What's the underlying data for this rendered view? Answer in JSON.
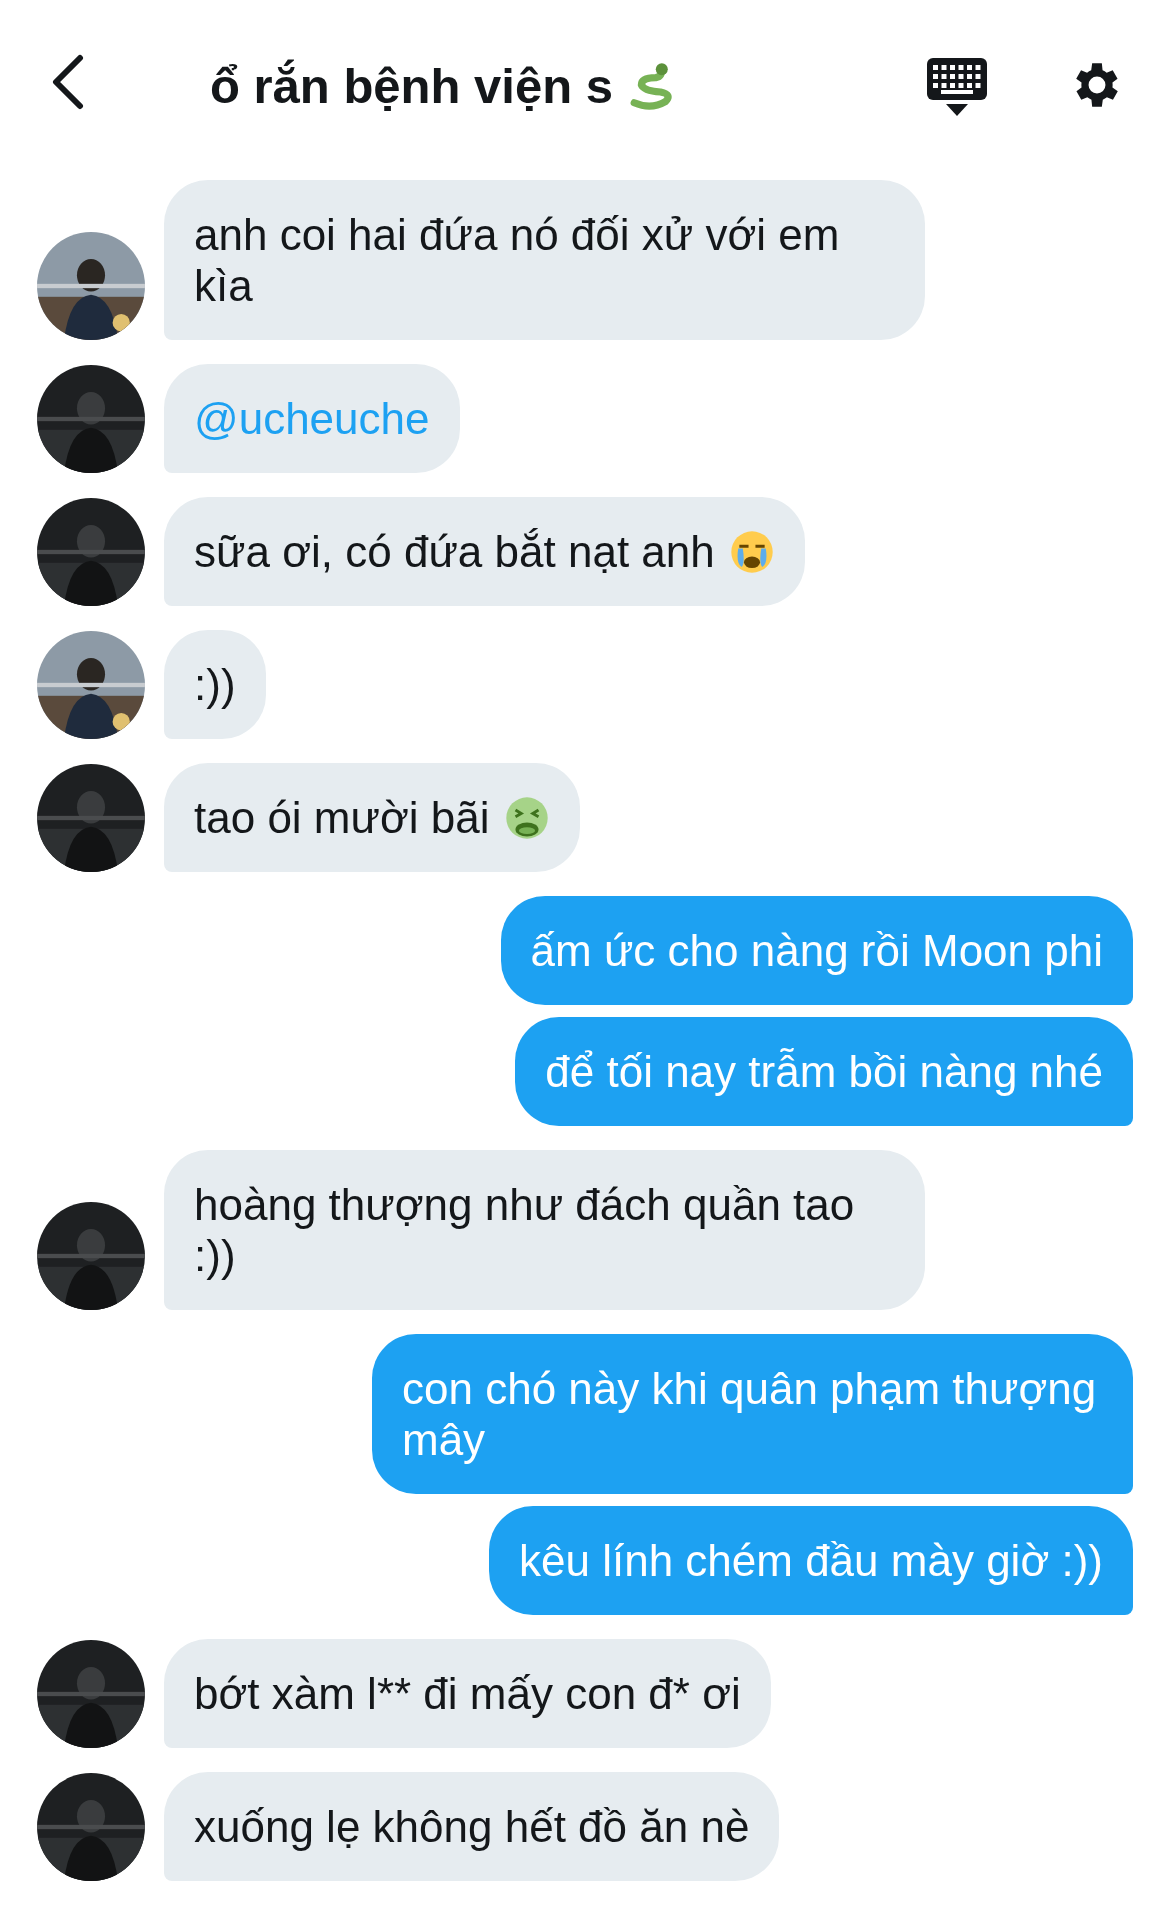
{
  "header": {
    "title": "ổ rắn bệnh viện s",
    "title_icon": {
      "kind": "snake"
    }
  },
  "messages": [
    {
      "kind": "received",
      "text": "anh coi hai đứa nó đối xử với em kìa"
    },
    {
      "kind": "mention",
      "text": "@ucheuche"
    },
    {
      "kind": "received",
      "text": "sữa ơi, có đứa bắt nạt anh",
      "icon": {
        "kind": "crying"
      }
    },
    {
      "kind": "received",
      "text": ":))"
    },
    {
      "kind": "received",
      "text": "tao ói mười bãi",
      "icon": {
        "kind": "nauseated"
      }
    },
    {
      "kind": "sent",
      "text": "ấm ức cho nàng rồi Moon phi"
    },
    {
      "kind": "sent",
      "text": "để tối nay trẫm bồi nàng nhé"
    },
    {
      "kind": "received",
      "text": "hoàng thượng như đách quần tao :))"
    },
    {
      "kind": "sent",
      "text": "con chó này khi quân phạm thượng mây"
    },
    {
      "kind": "sent",
      "text": "kêu lính chém đầu mày giờ :))"
    },
    {
      "kind": "received",
      "text": "bớt xàm l** đi mấy con đ* ơi"
    },
    {
      "kind": "received",
      "text": "xuống lẹ không hết đồ ăn nè"
    }
  ]
}
